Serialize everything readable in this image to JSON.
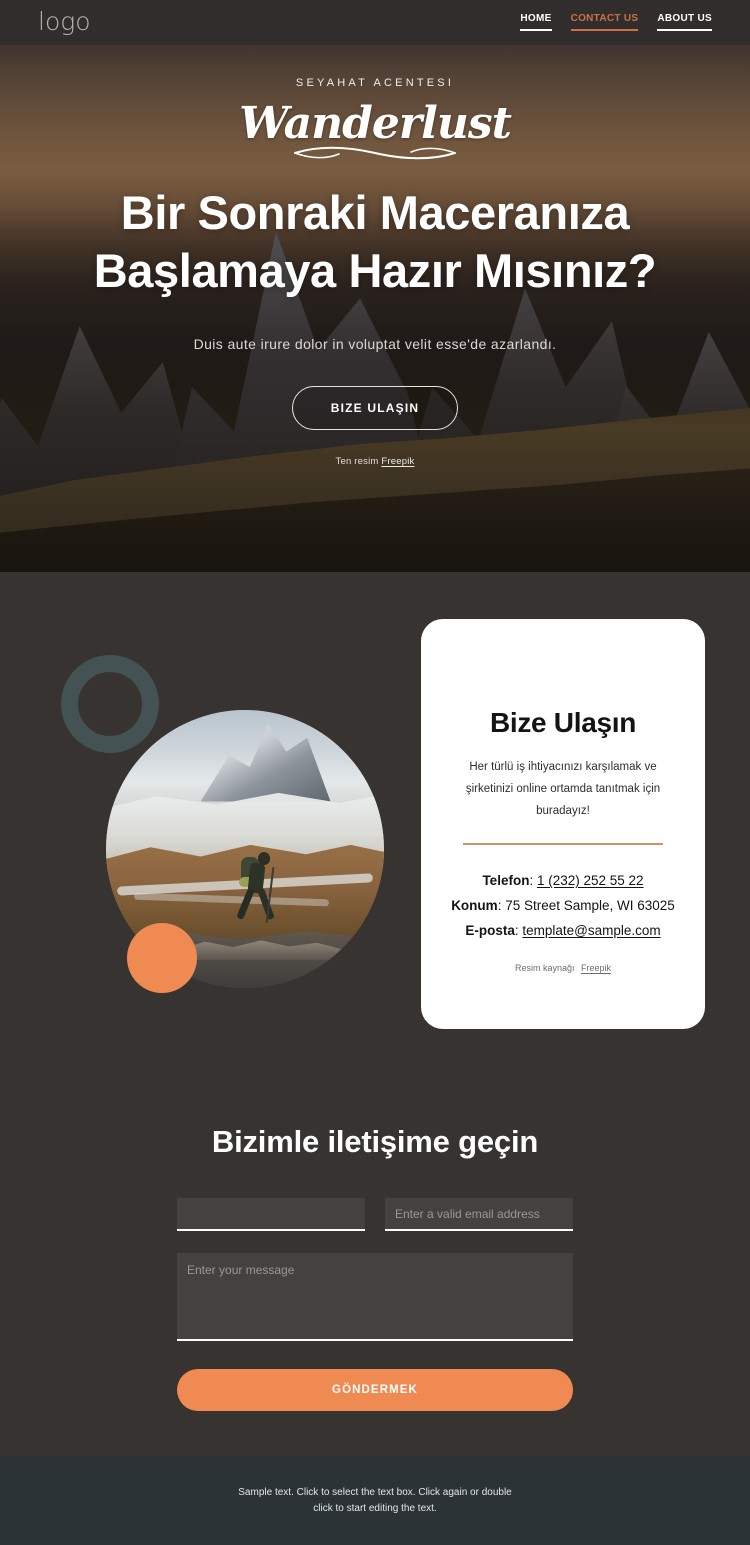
{
  "header": {
    "logo": "logo",
    "nav": [
      {
        "label": "HOME",
        "active": false
      },
      {
        "label": "CONTACT US",
        "active": true
      },
      {
        "label": "ABOUT US",
        "active": false
      }
    ]
  },
  "hero": {
    "eyebrow": "SEYAHAT ACENTESI",
    "brand": "Wanderlust",
    "title": "Bir Sonraki Maceranıza Başlamaya Hazır Mısınız?",
    "subtitle": "Duis aute irure dolor in voluptat velit esse'de azarlandı.",
    "button": "BIZE ULAŞIN",
    "credit_prefix": "Ten resim",
    "credit_link": "Freepik"
  },
  "contact_card": {
    "title": "Bize Ulaşın",
    "description": "Her türlü iş ihtiyacınızı karşılamak ve şirketinizi online ortamda tanıtmak için buradayız!",
    "phone_label": "Telefon",
    "phone_value": "1 (232) 252 55 22",
    "location_label": "Konum",
    "location_value": "75 Street Sample, WI 63025",
    "email_label": "E-posta",
    "email_value": "template@sample.com",
    "credit_prefix": "Resim kaynağı",
    "credit_link": "Freepik"
  },
  "form": {
    "title": "Bizimle iletişime geçin",
    "name_value": "",
    "name_placeholder": "",
    "email_placeholder": "Enter a valid email address",
    "email_value": "",
    "message_placeholder": "Enter your message",
    "message_value": "",
    "submit_label": "GÖNDERMEK"
  },
  "footer": {
    "line1": "Sample text. Click to select the text box. Click again or double",
    "line2": "click to start editing the text."
  },
  "colors": {
    "accent_orange": "#ef8b52",
    "nav_active": "#cc7046",
    "ring_teal": "#435353",
    "page_dark": "#363331",
    "footer_dark": "#2c3336",
    "card_rule": "#d39165"
  }
}
